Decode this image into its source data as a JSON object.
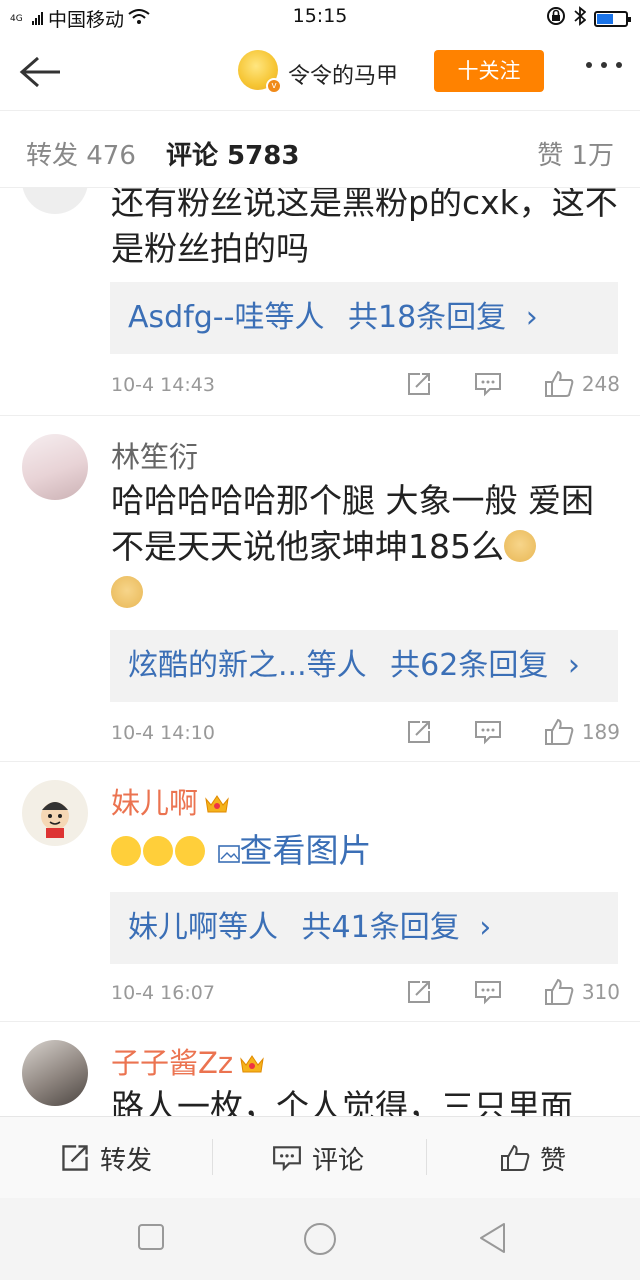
{
  "status_bar": {
    "signal_label": "4G",
    "carrier": "中国移动",
    "time": "15:15"
  },
  "header": {
    "username": "令令的马甲",
    "follow_label": "十关注",
    "verified_mark": "v"
  },
  "tabs": {
    "repost": "转发 476",
    "comment": "评论 5783",
    "like": "赞 1万"
  },
  "comments": [
    {
      "text": "还有粉丝说这是黑粉p的cxk，这不是粉丝拍的吗",
      "reply_users": "Asdfg--哇等人",
      "reply_count": "共18条回复",
      "time": "10-4 14:43",
      "likes": "248"
    },
    {
      "name": "林笙衍",
      "text": "哈哈哈哈哈那个腿 大象一般 爱困不是天天说他家坤坤185么",
      "reply_users": "炫酷的新之...等人",
      "reply_count": "共62条回复",
      "time": "10-4 14:10",
      "likes": "189"
    },
    {
      "name": "妹儿啊",
      "link_text": "查看图片",
      "reply_users": "妹儿啊等人",
      "reply_count": "共41条回复",
      "time": "10-4 16:07",
      "likes": "310"
    },
    {
      "name": "子子酱Zz",
      "text": "路人一枚，个人觉得，三只里面"
    }
  ],
  "bottom_bar": {
    "repost": "转发",
    "comment": "评论",
    "like": "赞"
  },
  "colors": {
    "accent_orange": "#ff8200",
    "link_blue": "#3b6fb6",
    "vip_name": "#eb7350"
  }
}
